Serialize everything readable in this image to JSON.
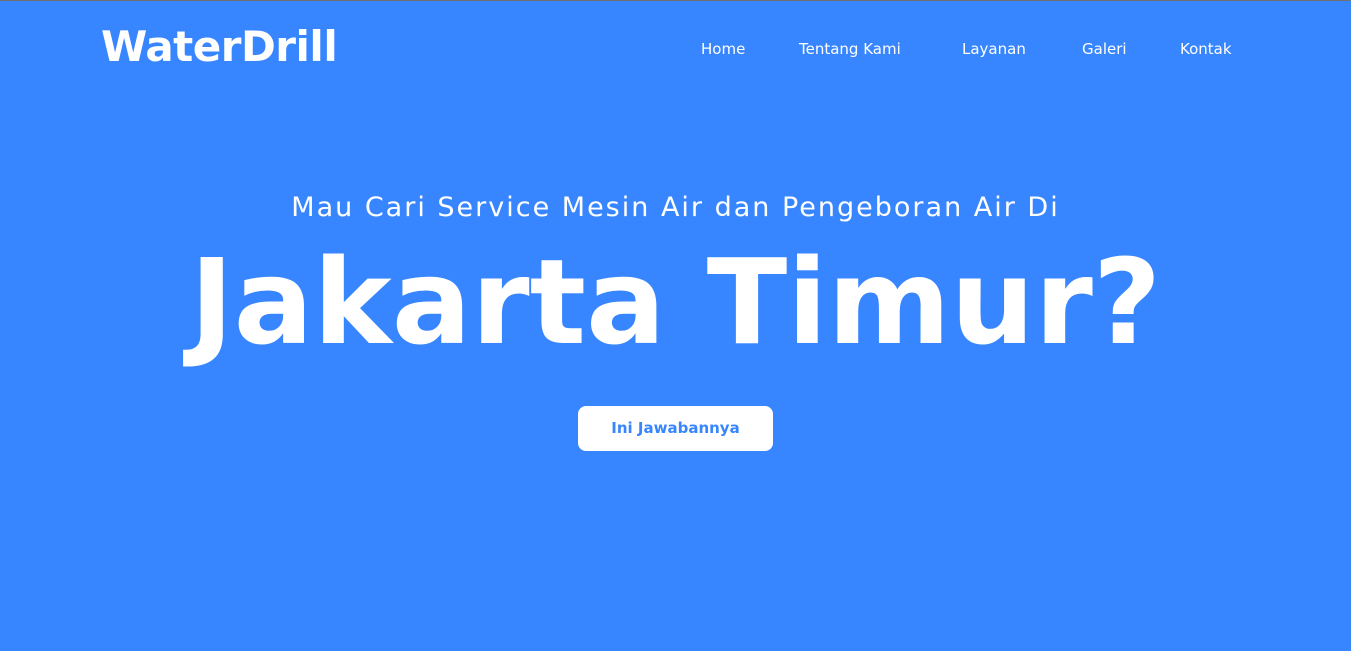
{
  "brand": {
    "name": "WaterDrill"
  },
  "nav": {
    "items": [
      {
        "label": "Home"
      },
      {
        "label": "Tentang Kami"
      },
      {
        "label": "Layanan"
      },
      {
        "label": "Galeri"
      },
      {
        "label": "Kontak"
      }
    ]
  },
  "hero": {
    "subtitle": "Mau Cari Service Mesin Air dan Pengeboran Air Di",
    "title": "Jakarta Timur?",
    "button_label": "Ini Jawabannya"
  },
  "colors": {
    "background": "#3886ff",
    "text": "#ffffff",
    "button_text": "#3886ff"
  }
}
